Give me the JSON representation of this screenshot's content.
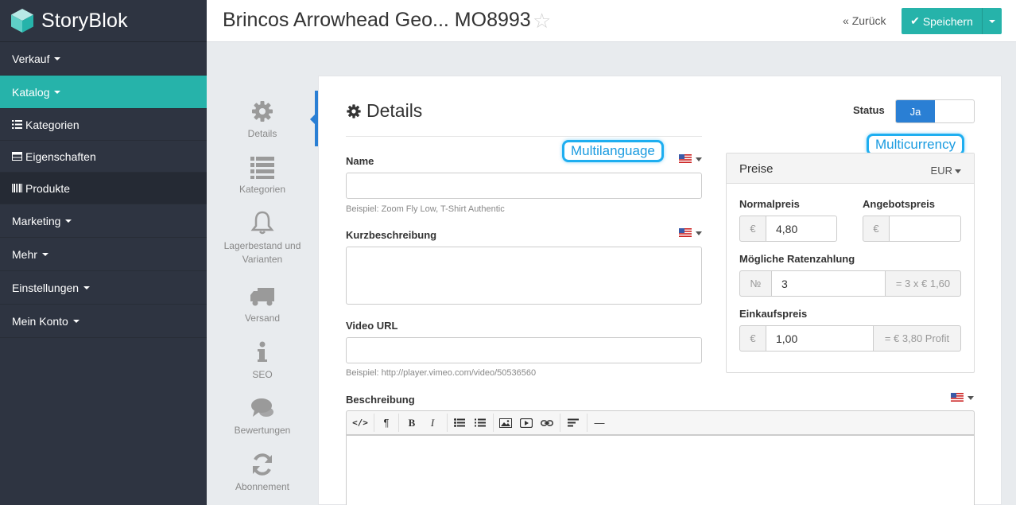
{
  "app": {
    "name": "StoryBlok"
  },
  "sidebar": {
    "items": [
      {
        "label": "Verkauf"
      },
      {
        "label": "Katalog"
      },
      {
        "label": "Kategorien"
      },
      {
        "label": "Eigenschaften"
      },
      {
        "label": "Produkte"
      },
      {
        "label": "Marketing"
      },
      {
        "label": "Mehr"
      },
      {
        "label": "Einstellungen"
      },
      {
        "label": "Mein Konto"
      }
    ]
  },
  "header": {
    "title": "Brincos Arrowhead Geo... MO8993",
    "back_label": "Zurück",
    "save_label": "Speichern"
  },
  "tabs": [
    {
      "label": "Details",
      "icon": "gear-icon"
    },
    {
      "label": "Kategorien",
      "icon": "list-icon"
    },
    {
      "label": "Lagerbestand und Varianten",
      "icon": "bell-icon"
    },
    {
      "label": "Versand",
      "icon": "truck-icon"
    },
    {
      "label": "SEO",
      "icon": "info-icon"
    },
    {
      "label": "Bewertungen",
      "icon": "comments-icon"
    },
    {
      "label": "Abonnement",
      "icon": "refresh-icon"
    }
  ],
  "details": {
    "title": "Details",
    "status_label": "Status",
    "status_value": "Ja",
    "name_label": "Name",
    "name_value": "",
    "name_help": "Beispiel: Zoom Fly Low, T-Shirt Authentic",
    "short_desc_label": "Kurzbeschreibung",
    "short_desc_value": "",
    "video_label": "Video URL",
    "video_value": "",
    "video_help": "Beispiel: http://player.vimeo.com/video/50536560",
    "desc_label": "Beschreibung"
  },
  "callouts": {
    "multilanguage": "Multilanguage",
    "multicurrency": "Multicurrency"
  },
  "prices": {
    "title": "Preise",
    "currency": "EUR",
    "regular_label": "Normalpreis",
    "regular_addon": "€",
    "regular_value": "4,80",
    "offer_label": "Angebotspreis",
    "offer_addon": "€",
    "offer_value": "",
    "installment_label": "Mögliche Ratenzahlung",
    "installment_addon": "№",
    "installment_value": "3",
    "installment_result": "= 3 x € 1,60",
    "purchase_label": "Einkaufspreis",
    "purchase_addon": "€",
    "purchase_value": "1,00",
    "purchase_result": "= € 3,80 Profit"
  },
  "colors": {
    "sidebar_bg": "#2e3441",
    "accent": "#26b3aa",
    "blue": "#2a7fd4",
    "callout": "#1eaef0"
  }
}
